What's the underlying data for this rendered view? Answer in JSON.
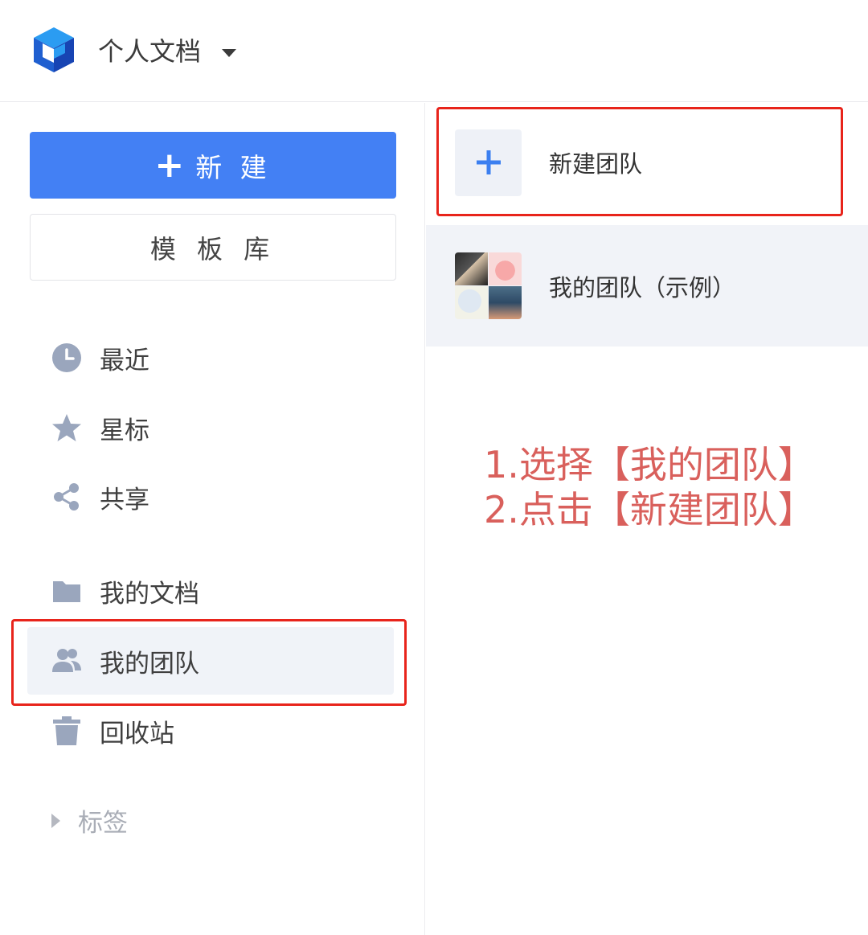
{
  "header": {
    "workspace_title": "个人文档"
  },
  "sidebar": {
    "new_button_label": "新 建",
    "template_button_label": "模 板 库",
    "items": [
      {
        "label": "最近",
        "icon": "clock-icon"
      },
      {
        "label": "星标",
        "icon": "star-icon"
      },
      {
        "label": "共享",
        "icon": "share-icon"
      },
      {
        "label": "我的文档",
        "icon": "folder-icon"
      },
      {
        "label": "我的团队",
        "icon": "team-icon",
        "active": true
      },
      {
        "label": "回收站",
        "icon": "trash-icon"
      }
    ],
    "tags_label": "标签"
  },
  "main": {
    "new_team_label": "新建团队",
    "team_label": "我的团队（示例）"
  },
  "annotation": {
    "line1": "1.选择【我的团队】",
    "line2": "2.点击【新建团队】"
  },
  "colors": {
    "primary": "#4380f4",
    "highlight_border": "#e8241b",
    "annotation_text": "#d9605c",
    "nav_icon": "#9aa6bd",
    "active_bg": "#f0f3f8"
  }
}
